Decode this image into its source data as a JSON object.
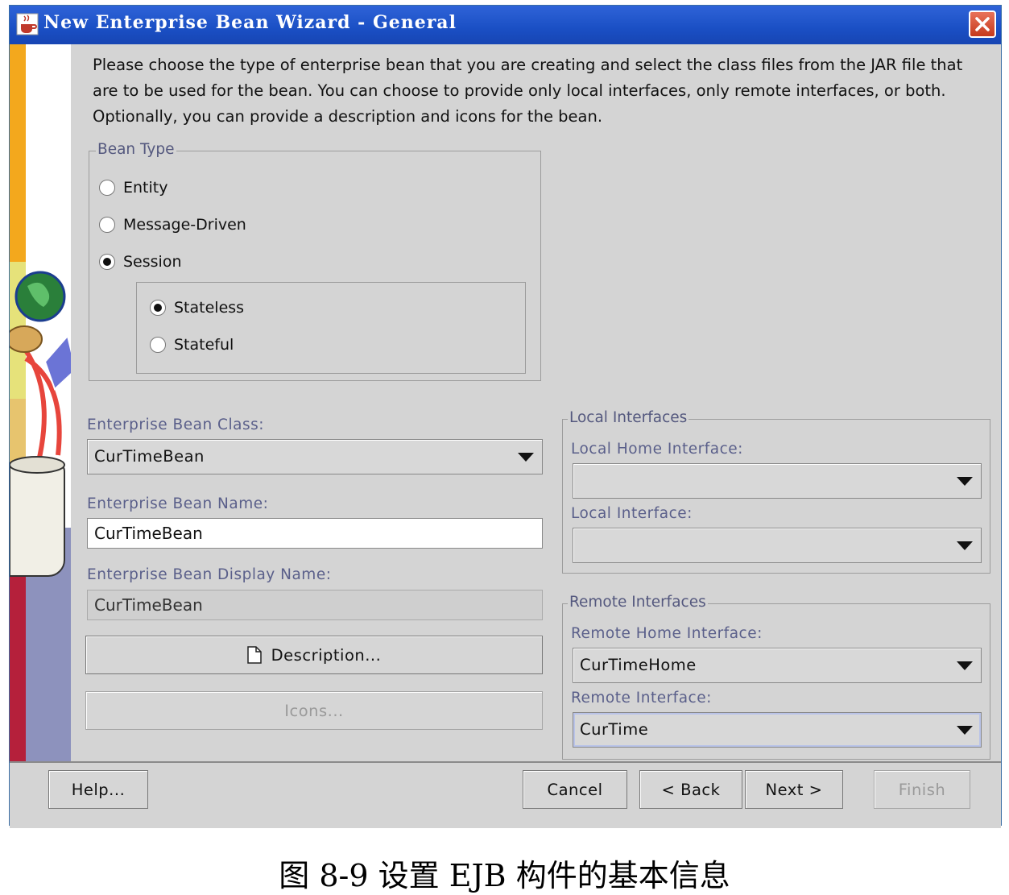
{
  "window": {
    "title": "New Enterprise Bean Wizard - General"
  },
  "intro": "Please choose the type of enterprise bean that you are creating and select the class files from the JAR file that are to be used for the bean.  You can choose to provide only local interfaces, only remote interfaces, or both. Optionally, you can provide a description and icons for the bean.",
  "bean_type": {
    "title": "Bean Type",
    "options": [
      "Entity",
      "Message-Driven",
      "Session"
    ],
    "selected": "Session",
    "session_options": [
      "Stateless",
      "Stateful"
    ],
    "session_selected": "Stateless"
  },
  "bean_class": {
    "label": "Enterprise Bean Class:",
    "value": "CurTimeBean"
  },
  "bean_name": {
    "label": "Enterprise Bean Name:",
    "value": "CurTimeBean"
  },
  "display_name": {
    "label": "Enterprise Bean Display Name:",
    "value": "CurTimeBean"
  },
  "description_button": "Description...",
  "icons_button": "Icons...",
  "local": {
    "title": "Local Interfaces",
    "home_label": "Local Home Interface:",
    "home_value": "",
    "iface_label": "Local Interface:",
    "iface_value": ""
  },
  "remote": {
    "title": "Remote Interfaces",
    "home_label": "Remote Home Interface:",
    "home_value": "CurTimeHome",
    "iface_label": "Remote Interface:",
    "iface_value": "CurTime"
  },
  "footer": {
    "help": "Help...",
    "cancel": "Cancel",
    "back": "< Back",
    "next": "Next >",
    "finish": "Finish"
  },
  "caption": "图 8-9 设置 EJB 构件的基本信息",
  "colors": {
    "titlebar": "#1a4fc4",
    "label": "#5a5f8a",
    "panel": "#d4d4d4"
  }
}
